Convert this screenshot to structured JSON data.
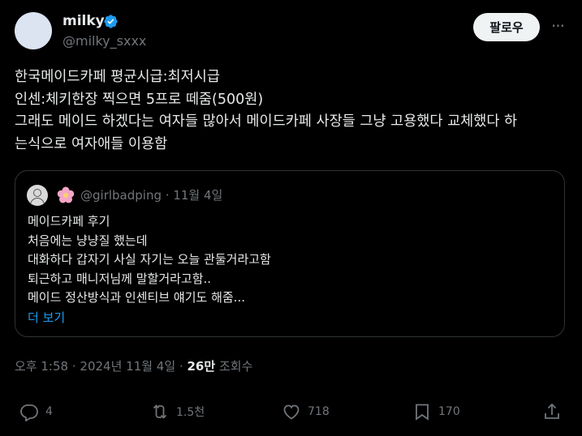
{
  "author": {
    "name": "milky",
    "handle": "@milky_sxxx",
    "follow_label": "팔로우",
    "more_label": "···"
  },
  "post": {
    "lines": [
      "한국메이드카페 평균시급:최저시급",
      "인센:체키한장 찍으면 5프로 떼줌(500원)",
      "그래도 메이드 하겠다는 여자들 많아서 메이드카페 사장들 그냥 고용했다 교체했다 하",
      "는식으로 여자애들 이용함"
    ]
  },
  "quote": {
    "handle": "@girlbadping",
    "sep": "·",
    "date": "11월 4일",
    "lines": [
      "메이드카페 후기",
      "처음에는 냥냥질 했는데",
      "대화하다 갑자기 사실 자기는 오늘 관둘거라고함",
      "퇴근하고 매니저님께 말할거라고함..",
      "메이드 정산방식과 인센티브 얘기도 해줌..."
    ],
    "more_label": "더 보기"
  },
  "meta": {
    "time": "오후 1:58",
    "date": "2024년 11월 4일",
    "views_count": "26만",
    "views_label": "조회수",
    "sep": "·"
  },
  "actions": {
    "replies": "4",
    "reposts": "1.5천",
    "likes": "718",
    "bookmarks": "170"
  },
  "colors": {
    "accent": "#1d9bf0",
    "muted": "#71767b",
    "text": "#e7e9ea",
    "border": "#2f3336"
  }
}
